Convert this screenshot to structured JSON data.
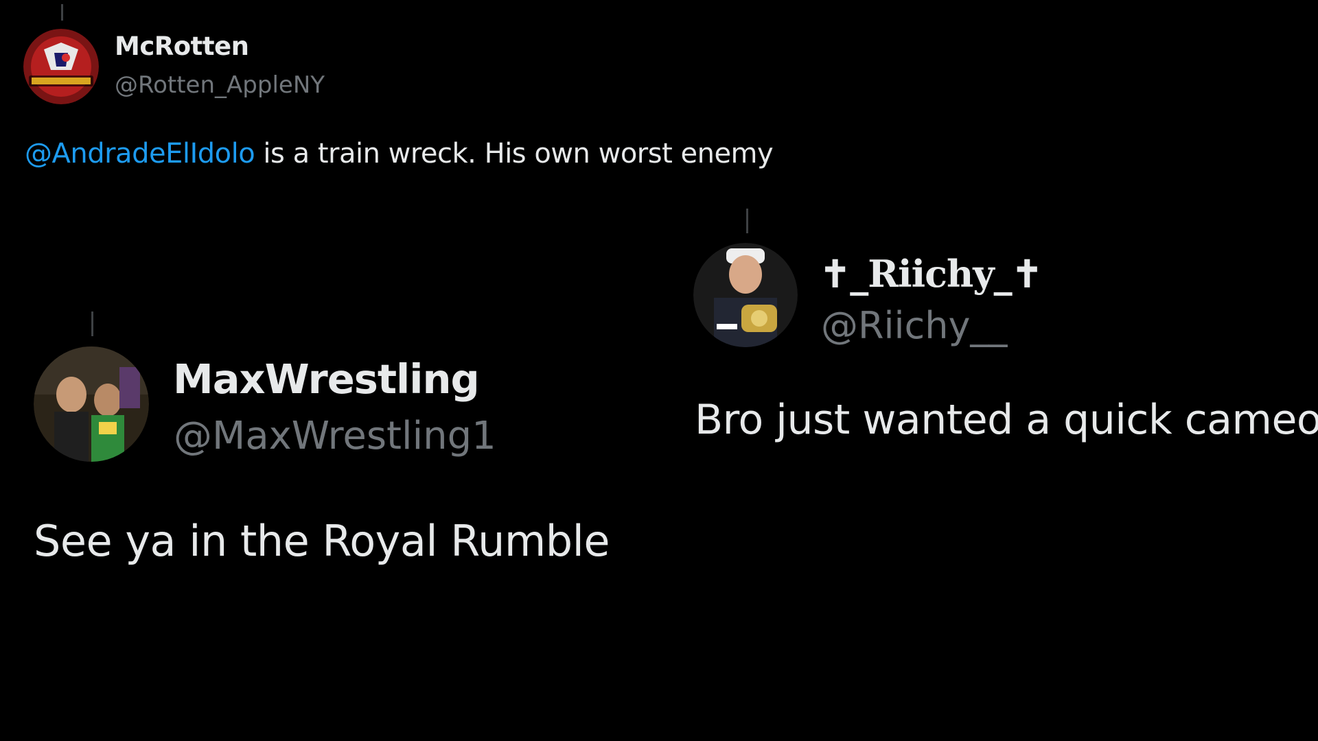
{
  "tweets": [
    {
      "display_name": "McRotten",
      "handle": "@Rotten_AppleNY",
      "avatar_icon": "mcrotten-logo-avatar",
      "text_mention": "@AndradeElIdolo",
      "text_rest": " is a train wreck. His own worst enemy"
    },
    {
      "display_name": "MaxWrestling",
      "handle": "@MaxWrestling1",
      "avatar_icon": "wrestlers-photo-avatar",
      "text": "See ya in the Royal Rumble"
    },
    {
      "display_name": "✝_Riichy_✝",
      "handle": "@Riichy__",
      "avatar_icon": "person-with-belt-avatar",
      "text": "Bro just wanted a quick cameo"
    }
  ],
  "colors": {
    "background": "#000000",
    "text": "#e7e9ea",
    "secondary": "#71767b",
    "mention": "#1d9bf0",
    "thread_line": "#3e4144"
  }
}
